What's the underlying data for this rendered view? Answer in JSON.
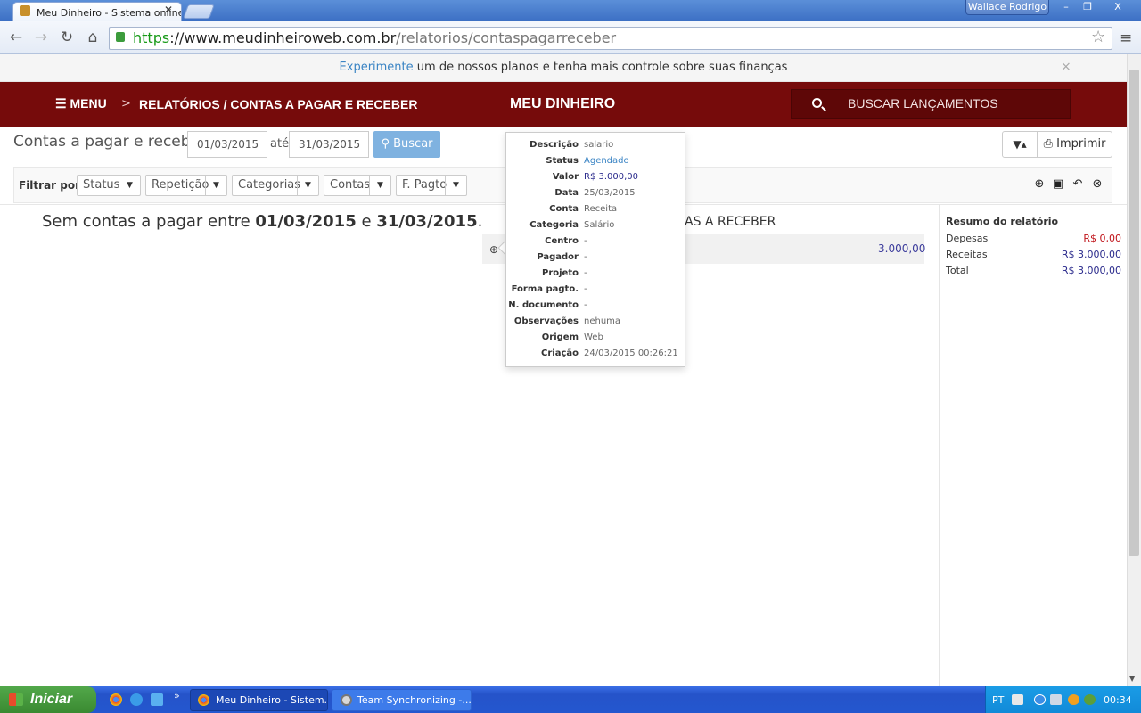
{
  "browser": {
    "tab_title": "Meu Dinheiro - Sistema online",
    "tab_close": "✕",
    "user_name": "Wallace Rodrigo",
    "window_buttons": [
      "–",
      "❐",
      "X"
    ],
    "url_scheme": "https",
    "url_host": "://www.meudinheiroweb.com.br",
    "url_path": "/relatorios/contaspagarreceber",
    "nav_back": "←",
    "nav_forward": "→",
    "nav_reload": "↻",
    "nav_home": "⌂",
    "star": "☆",
    "menu": "≡"
  },
  "infobar": {
    "link": "Experimente",
    "text": " um de nossos planos e tenha mais controle sobre suas finanças",
    "close": "×"
  },
  "navbar": {
    "menu": "MENU",
    "crumb_sep": ">",
    "breadcrumb": "RELATÓRIOS / CONTAS A PAGAR E RECEBER",
    "brand": "MEU DINHEIRO",
    "search_placeholder": "BUSCAR LANÇAMENTOS"
  },
  "toolbar": {
    "title": "Contas a pagar e receber",
    "date_from": "01/03/2015",
    "date_sep": "até",
    "date_to": "31/03/2015",
    "search_button": "Buscar",
    "filter_icon": "▼▴",
    "print_button": "Imprimir"
  },
  "filters": {
    "label": "Filtrar por:",
    "items": [
      "Status",
      "Repetição",
      "Categorias",
      "Contas",
      "F. Pagto"
    ],
    "caret": "▼",
    "action_icons": [
      "⊕",
      "▣",
      "↶",
      "⊗"
    ]
  },
  "content": {
    "empty_prefix": "Sem contas a pagar entre ",
    "empty_date_from": "01/03/2015",
    "empty_mid": " e ",
    "empty_date_to": "31/03/2015",
    "empty_suffix": ".",
    "receivables_header": "AS A RECEBER",
    "row_value": "3.000,00"
  },
  "summary": {
    "title": "Resumo do relatório",
    "rows": [
      {
        "label": "Depesas",
        "value": "R$ 0,00",
        "color": "#c0141a"
      },
      {
        "label": "Receitas",
        "value": "R$ 3.000,00",
        "color": "#2a2a8c"
      },
      {
        "label": "Total",
        "value": "R$ 3.000,00",
        "color": "#2a2a8c"
      }
    ]
  },
  "popover": {
    "rows": [
      {
        "label": "Descrição",
        "value": "salario"
      },
      {
        "label": "Status",
        "value": "Agendado",
        "color": "#3a84c4"
      },
      {
        "label": "Valor",
        "value": "R$ 3.000,00",
        "color": "#2a2a8c"
      },
      {
        "label": "Data",
        "value": "25/03/2015"
      },
      {
        "label": "Conta",
        "value": "Receita"
      },
      {
        "label": "Categoria",
        "value": "Salário"
      },
      {
        "label": "Centro",
        "value": "-"
      },
      {
        "label": "Pagador",
        "value": "-"
      },
      {
        "label": "Projeto",
        "value": "-"
      },
      {
        "label": "Forma pagto.",
        "value": "-"
      },
      {
        "label": "N. documento",
        "value": "-"
      },
      {
        "label": "Observações",
        "value": "nehuma"
      },
      {
        "label": "Origem",
        "value": "Web"
      },
      {
        "label": "Criação",
        "value": "24/03/2015 00:26:21"
      }
    ]
  },
  "taskbar": {
    "start": "Iniciar",
    "quicklaunch_more": "»",
    "tasks": [
      {
        "label": "Meu Dinheiro - Sistem..."
      },
      {
        "label": "Team Synchronizing -..."
      }
    ],
    "lang": "PT",
    "clock": "00:34"
  }
}
